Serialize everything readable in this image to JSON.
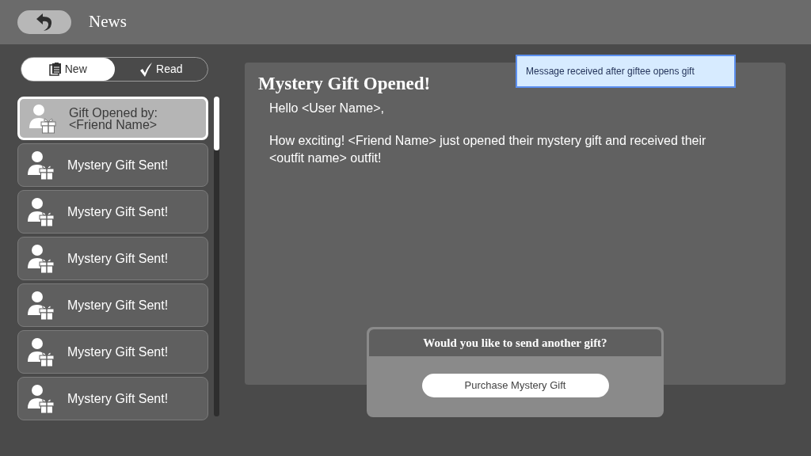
{
  "header": {
    "title": "News"
  },
  "tabs": [
    {
      "label": "New",
      "kind": "clipboard",
      "selected": true
    },
    {
      "label": "Read",
      "kind": "check",
      "selected": false
    }
  ],
  "messages": [
    {
      "label": "Gift Opened by:\n<Friend Name>",
      "selected": true
    },
    {
      "label": "Mystery Gift Sent!",
      "selected": false
    },
    {
      "label": "Mystery Gift Sent!",
      "selected": false
    },
    {
      "label": "Mystery Gift Sent!",
      "selected": false
    },
    {
      "label": "Mystery Gift Sent!",
      "selected": false
    },
    {
      "label": "Mystery Gift Sent!",
      "selected": false
    },
    {
      "label": "Mystery Gift Sent!",
      "selected": false
    }
  ],
  "detail": {
    "title": "Mystery Gift Opened!",
    "paragraphs": [
      "Hello <User Name>,",
      "How exciting!  <Friend Name> just opened their mystery gift and received their <outfit name> outfit!"
    ]
  },
  "annotation": "Message received after giftee opens gift",
  "dialog": {
    "question": "Would you like to send another gift?",
    "button": "Purchase Mystery Gift"
  }
}
